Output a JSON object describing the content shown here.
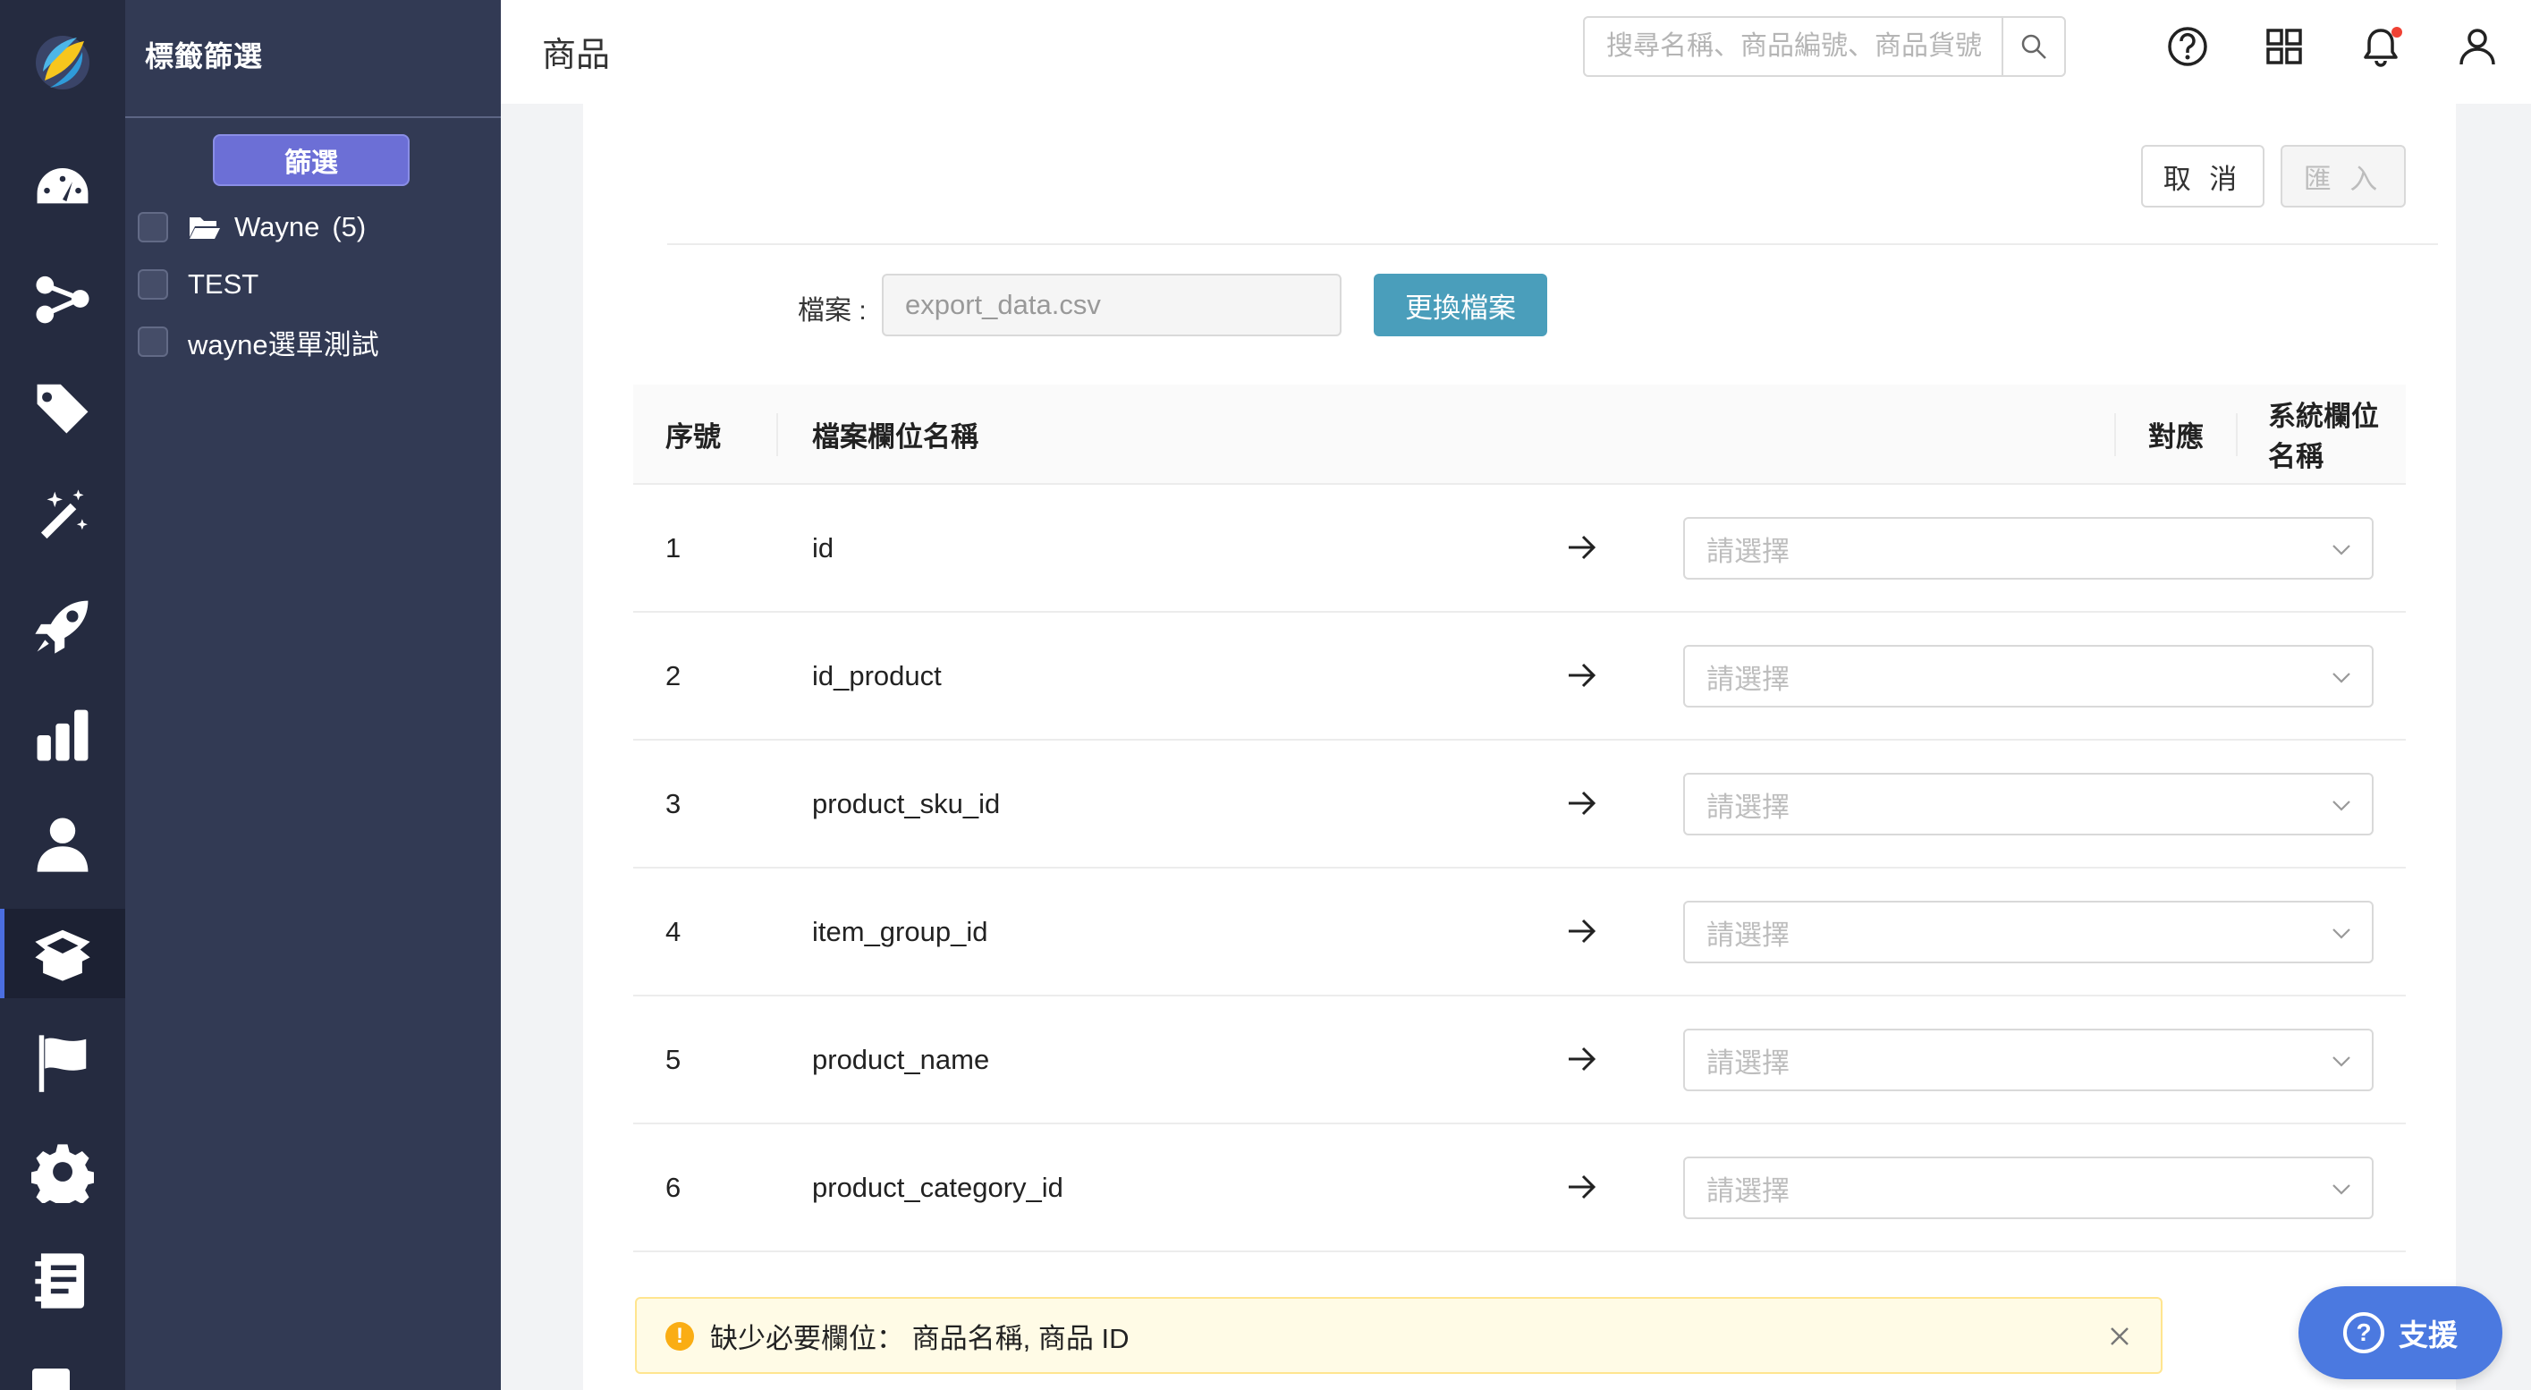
{
  "header": {
    "page_title": "商品",
    "search_placeholder": "搜尋名稱、商品編號、商品貨號"
  },
  "tag_panel": {
    "title": "標籤篩選",
    "filter_button": "篩選",
    "tags": [
      {
        "label": "Wayne",
        "count": "(5)",
        "is_folder": true
      },
      {
        "label": "TEST",
        "count": "",
        "is_folder": false
      },
      {
        "label": "wayne選單測試",
        "count": "",
        "is_folder": false
      }
    ]
  },
  "nav": {
    "icons": [
      "dashboard-icon",
      "share-nodes-icon",
      "tag-icon",
      "magic-wand-icon",
      "rocket-icon",
      "bar-chart-icon",
      "user-icon",
      "box-open-icon",
      "flag-icon",
      "gear-icon",
      "notebook-icon"
    ],
    "active": "box-open-icon"
  },
  "actions": {
    "cancel": "取 消",
    "import": "匯 入"
  },
  "file": {
    "label": "檔案 :",
    "name": "export_data.csv",
    "change_button": "更換檔案"
  },
  "table": {
    "headers": {
      "no": "序號",
      "file_field": "檔案欄位名稱",
      "map": "對應",
      "system_field": "系統欄位名稱"
    },
    "select_placeholder": "請選擇",
    "rows": [
      {
        "no": "1",
        "name": "id"
      },
      {
        "no": "2",
        "name": "id_product"
      },
      {
        "no": "3",
        "name": "product_sku_id"
      },
      {
        "no": "4",
        "name": "item_group_id"
      },
      {
        "no": "5",
        "name": "product_name"
      },
      {
        "no": "6",
        "name": "product_category_id"
      }
    ]
  },
  "alert": {
    "icon": "warning-icon",
    "message": "缺少必要欄位： 商品名稱, 商品 ID"
  },
  "support": {
    "label": "支援"
  },
  "colors": {
    "rail_bg": "#252b40",
    "panel_bg": "#323a54",
    "filter_btn": "#6c6fd6",
    "change_btn": "#4a9ebb",
    "support_btn": "#4b79e0",
    "alert_bg": "#fffbe6",
    "alert_icon": "#faad14",
    "notify_dot": "#f04134"
  }
}
